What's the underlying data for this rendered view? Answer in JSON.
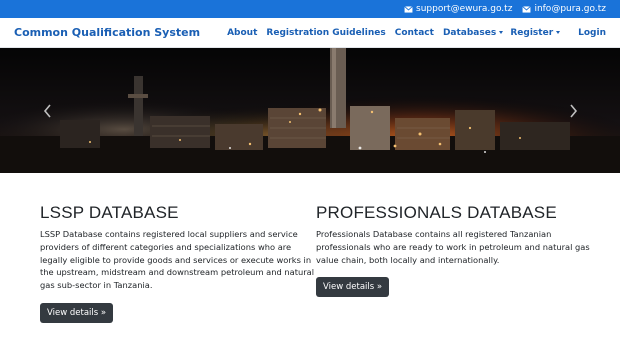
{
  "topbar": {
    "contacts": [
      {
        "icon": "envelope-icon",
        "label": "support@ewura.go.tz"
      },
      {
        "icon": "envelope-icon",
        "label": "info@pura.go.tz"
      }
    ]
  },
  "navbar": {
    "brand": "Common Qualification System",
    "left_links": [
      "About",
      "Registration Guidelines",
      "Contact",
      "Databases"
    ],
    "register": "Register",
    "login": "Login"
  },
  "colors": {
    "topbar_bg": "#1a73d9",
    "brand_blue": "#1a5fb4",
    "button_dark": "#343a40"
  },
  "carousel": {
    "prev_icon": "chevron-left-icon",
    "next_icon": "chevron-right-icon"
  },
  "sections": [
    {
      "title": "LSSP DATABASE",
      "text": "LSSP Database contains registered local suppliers and service providers of different categories and specializations who are legally eligible to provide goods and services or execute works in the upstream, midstream and downstream petroleum and natural gas sub-sector in Tanzania.",
      "button": "View details »"
    },
    {
      "title": "PROFESSIONALS DATABASE",
      "text": "Professionals Database contains all registered Tanzanian professionals who are ready to work in petroleum and natural gas value chain, both locally and internationally.",
      "button": "View details »"
    }
  ]
}
